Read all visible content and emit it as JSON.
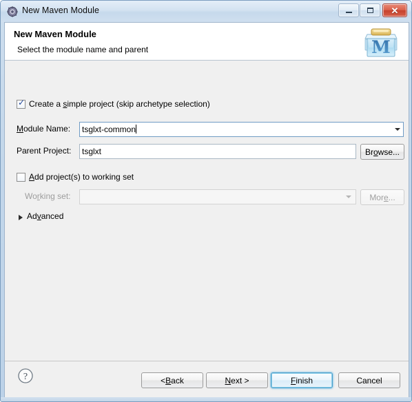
{
  "window": {
    "title": "New Maven Module",
    "icon": "maven-wizard-icon",
    "controls": {
      "minimize": "minimize-icon",
      "maximize": "maximize-icon",
      "close": "close-icon"
    }
  },
  "header": {
    "title": "New Maven Module",
    "subtitle": "Select the module name and parent",
    "icon_letter": "M",
    "icon_name": "maven-module-banner-icon"
  },
  "form": {
    "simple_project": {
      "label_pre": "Create a ",
      "label_mnemonic": "s",
      "label_post": "imple project (skip archetype selection)",
      "checked": true
    },
    "module_name": {
      "label_mnemonic": "M",
      "label_rest": "odule Name:",
      "value": "tsglxt-common",
      "dropdown_icon": "chevron-down-icon"
    },
    "parent_project": {
      "label": "Parent Project:",
      "value": "tsglxt",
      "browse_pre": "Br",
      "browse_mnemonic": "o",
      "browse_post": "wse..."
    },
    "working_set": {
      "checkbox_mnemonic": "A",
      "checkbox_rest": "dd project(s) to working set",
      "checked": false,
      "label_pre": "Wo",
      "label_mnemonic": "r",
      "label_post": "king set:",
      "value": "",
      "dropdown_icon": "chevron-down-icon",
      "more_pre": "Mor",
      "more_mnemonic": "e",
      "more_post": "...",
      "enabled": false
    },
    "advanced": {
      "label_pre": "Ad",
      "label_mnemonic": "v",
      "label_post": "anced",
      "expanded": false,
      "twistie_icon": "triangle-right-icon"
    }
  },
  "footer": {
    "help_icon": "help-question-icon",
    "buttons": {
      "back_pre": "< ",
      "back_mnemonic": "B",
      "back_post": "ack",
      "next_mnemonic": "N",
      "next_post": "ext >",
      "finish_pre": "",
      "finish_mnemonic": "F",
      "finish_post": "inish",
      "cancel": "Cancel"
    },
    "default_button": "Finish"
  },
  "colors": {
    "accent_default_button": "#4a9ecb",
    "close_button": "#c6412c",
    "title_bar": "#cfdfef",
    "body": "#f0f0f0",
    "maven_icon_blue": "#7fc3e8",
    "maven_icon_lid": "#e8c86a"
  }
}
